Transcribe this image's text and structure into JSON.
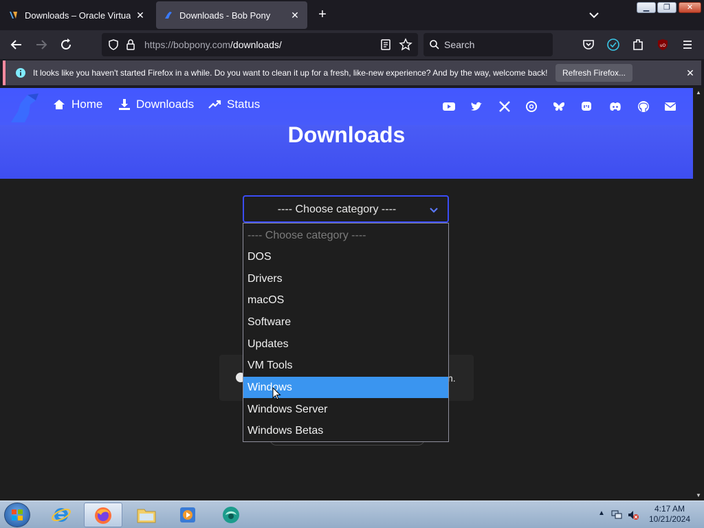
{
  "tabs": [
    {
      "title": "Downloads – Oracle VirtualBox",
      "favicon": "virtualbox-icon",
      "active": false
    },
    {
      "title": "Downloads - Bob Pony",
      "favicon": "bobpony-icon",
      "active": true
    }
  ],
  "address_bar": {
    "url_host": "https://bobpony.com",
    "url_path": "/downloads/"
  },
  "search_bar": {
    "placeholder": "Search"
  },
  "notification": {
    "message": "It looks like you haven't started Firefox in a while. Do you want to clean it up for a fresh, like-new experience? And by the way, welcome back!",
    "button": "Refresh Firefox..."
  },
  "site_nav": {
    "links": [
      {
        "label": "Home",
        "icon": "home-icon"
      },
      {
        "label": "Downloads",
        "icon": "download-icon"
      },
      {
        "label": "Status",
        "icon": "trend-icon"
      }
    ],
    "social": [
      "youtube-icon",
      "twitter-icon",
      "x-icon",
      "threads-icon",
      "bluesky-icon",
      "mastodon-icon",
      "discord-icon",
      "github-icon",
      "email-icon"
    ]
  },
  "page": {
    "title": "Downloads",
    "select_value": "---- Choose category ----",
    "info_tail": "n."
  },
  "dropdown": {
    "options": [
      {
        "label": "---- Choose category ----",
        "placeholder": true
      },
      {
        "label": "DOS"
      },
      {
        "label": "Drivers"
      },
      {
        "label": "macOS"
      },
      {
        "label": "Software"
      },
      {
        "label": "Updates"
      },
      {
        "label": "VM Tools"
      },
      {
        "label": "Windows",
        "selected": true
      },
      {
        "label": "Windows Server"
      },
      {
        "label": "Windows Betas"
      }
    ]
  },
  "taskbar": {
    "time": "4:17 AM",
    "date": "10/21/2024"
  },
  "colors": {
    "hero": "#3f55ff",
    "selection": "#3a95f0",
    "accent_border": "#3b4cf5"
  }
}
